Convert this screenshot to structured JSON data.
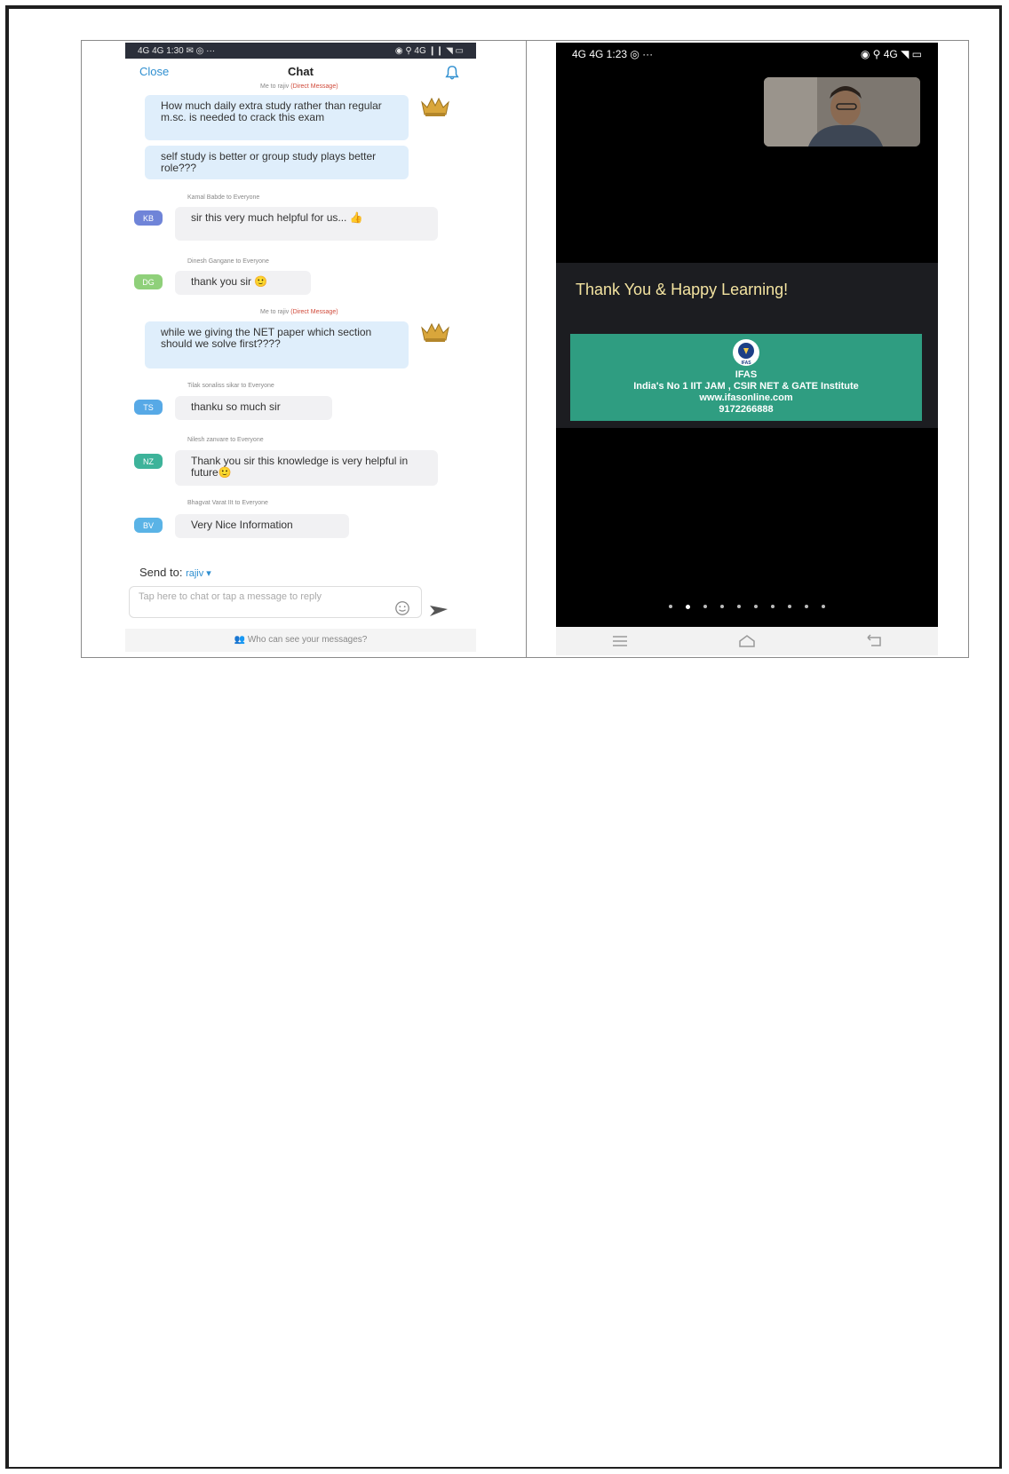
{
  "left_phone": {
    "status_bar": {
      "left": "4G 4G 1:30 ✉ ◎ ···",
      "right": "◉ ⚲ 4G ❙❙ ◥ ▭"
    },
    "header": {
      "close": "Close",
      "title": "Chat"
    },
    "messages": [
      {
        "meta": "Me to rajiv",
        "dm": "(Direct Message)",
        "text": "How much daily extra study rather than regular m.sc. is needed to crack this exam"
      },
      {
        "text": "self study is better or group study plays better role???"
      },
      {
        "meta": "Kamal Babde to Everyone",
        "avatar": "KB",
        "text": "sir this very much helpful for us... 👍"
      },
      {
        "meta": "Dinesh Gangane to Everyone",
        "avatar": "DG",
        "text": "thank you sir 🙂"
      },
      {
        "meta": "Me to rajiv",
        "dm": "(Direct Message)",
        "text": "while we giving the NET paper which section should we solve first????"
      },
      {
        "meta": "Tilak sonaliss sikar to Everyone",
        "avatar": "TS",
        "text": "thanku so much sir"
      },
      {
        "meta": "Nilesh zanvare to Everyone",
        "avatar": "NZ",
        "text": "Thank you sir this knowledge is very helpful in future🙂"
      },
      {
        "meta": "Bhagvat Varat IIt to Everyone",
        "avatar": "BV",
        "text": "Very Nice Information"
      }
    ],
    "send_to": {
      "label": "Send to:",
      "recipient": "rajiv ▾"
    },
    "input": {
      "placeholder": "Tap here to chat or tap a message to reply"
    },
    "footer": "👥 Who can see your messages?"
  },
  "right_phone": {
    "status_bar": {
      "left": "4G 4G 1:23 ◎ ···",
      "right": "◉ ⚲ 4G ◥ ▭"
    },
    "banner_title": "Thank You & Happy Learning!",
    "card": {
      "logo_label": "IFAS",
      "org": "IFAS",
      "tagline": "India's No 1 IIT JAM , CSIR NET & GATE Institute",
      "website": "www.ifasonline.com",
      "phone": "9172266888"
    },
    "page_indicator": {
      "count": 10,
      "active": 2
    }
  },
  "colors": {
    "avatar_kb": "#6f84d8",
    "avatar_dg": "#8fd07a",
    "avatar_ts": "#57a9e6",
    "avatar_nz": "#3db39a",
    "avatar_bv": "#5ab3e6",
    "card_green": "#2f9d81",
    "banner_text": "#f3e3a0"
  }
}
